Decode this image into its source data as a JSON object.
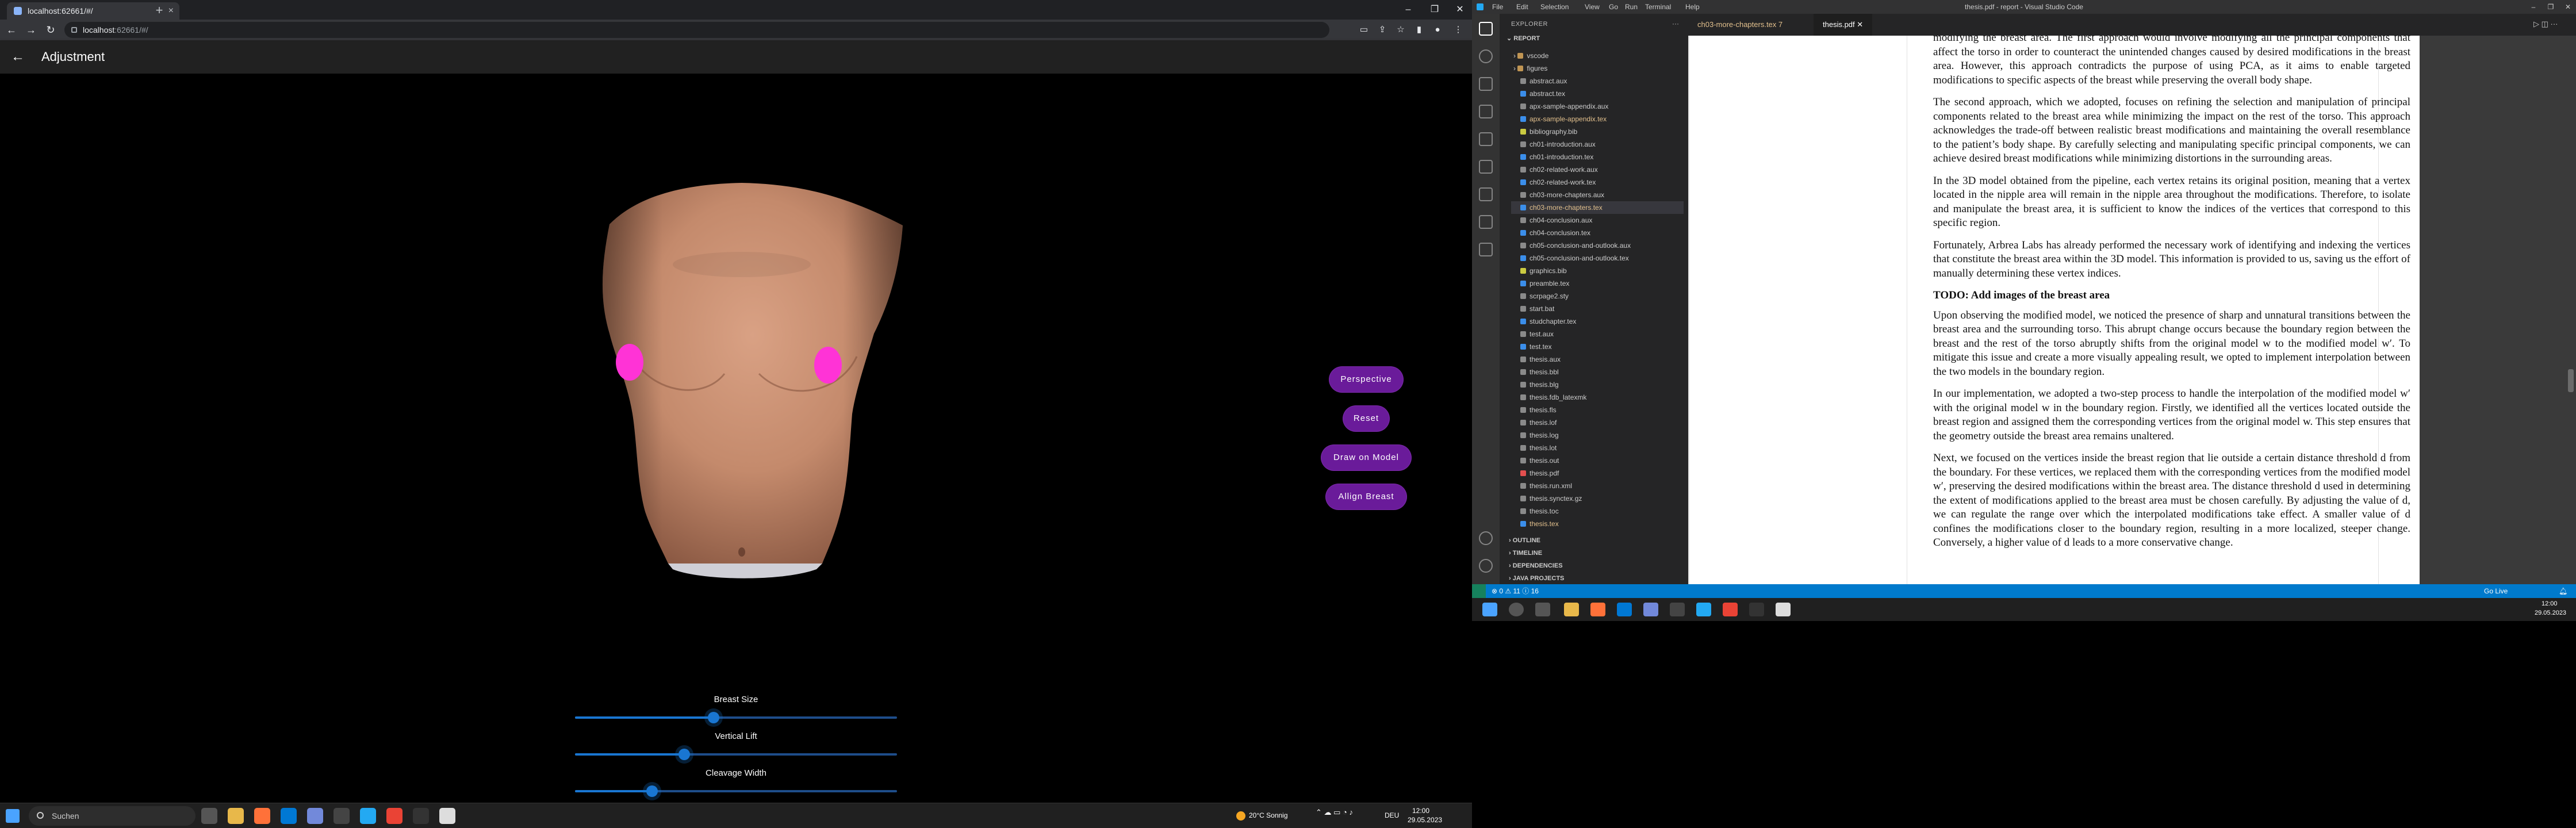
{
  "browser": {
    "tab_title": "localhost:62661/#/",
    "new_tab": "+",
    "url_host": "localhost",
    "url_rest": ":62661/#/"
  },
  "app": {
    "title": "Adjustment",
    "buttons": {
      "perspective": "Perspective",
      "reset": "Reset",
      "draw_on_model": "Draw on Model",
      "align_breast": "Allign Breast"
    },
    "sliders": [
      {
        "label": "Breast Size",
        "value": 0.43
      },
      {
        "label": "Vertical Lift",
        "value": 0.34
      },
      {
        "label": "Cleavage Width",
        "value": 0.24
      }
    ]
  },
  "left_taskbar": {
    "search_placeholder": "Suchen",
    "weather": "20°C  Sonnig",
    "lang": "DEU",
    "time": "12:00",
    "date": "29.05.2023"
  },
  "vscode": {
    "title": "thesis.pdf - report - Visual Studio Code",
    "menu": [
      "File",
      "Edit",
      "Selection",
      "View",
      "Go",
      "Run",
      "Terminal",
      "Help"
    ],
    "explorer_header": "EXPLORER",
    "root": "REPORT",
    "folders": [
      "vscode",
      "figures"
    ],
    "files": [
      {
        "name": "abstract.aux",
        "mod": false
      },
      {
        "name": "abstract.tex",
        "mod": false
      },
      {
        "name": "apx-sample-appendix.aux",
        "mod": false
      },
      {
        "name": "apx-sample-appendix.tex",
        "mod": true
      },
      {
        "name": "bibliography.bib",
        "mod": false
      },
      {
        "name": "ch01-introduction.aux",
        "mod": false
      },
      {
        "name": "ch01-introduction.tex",
        "mod": false
      },
      {
        "name": "ch02-related-work.aux",
        "mod": false
      },
      {
        "name": "ch02-related-work.tex",
        "mod": false
      },
      {
        "name": "ch03-more-chapters.aux",
        "mod": false
      },
      {
        "name": "ch03-more-chapters.tex",
        "mod": true
      },
      {
        "name": "ch04-conclusion.aux",
        "mod": false
      },
      {
        "name": "ch04-conclusion.tex",
        "mod": false
      },
      {
        "name": "ch05-conclusion-and-outlook.aux",
        "mod": false
      },
      {
        "name": "ch05-conclusion-and-outlook.tex",
        "mod": false
      },
      {
        "name": "graphics.bib",
        "mod": false
      },
      {
        "name": "preamble.tex",
        "mod": false
      },
      {
        "name": "scrpage2.sty",
        "mod": false
      },
      {
        "name": "start.bat",
        "mod": false
      },
      {
        "name": "studchapter.tex",
        "mod": false
      },
      {
        "name": "test.aux",
        "mod": false
      },
      {
        "name": "test.tex",
        "mod": false
      },
      {
        "name": "thesis.aux",
        "mod": false
      },
      {
        "name": "thesis.bbl",
        "mod": false
      },
      {
        "name": "thesis.blg",
        "mod": false
      },
      {
        "name": "thesis.fdb_latexmk",
        "mod": false
      },
      {
        "name": "thesis.fls",
        "mod": false
      },
      {
        "name": "thesis.lof",
        "mod": false
      },
      {
        "name": "thesis.log",
        "mod": false
      },
      {
        "name": "thesis.lot",
        "mod": false
      },
      {
        "name": "thesis.out",
        "mod": false
      },
      {
        "name": "thesis.pdf",
        "mod": false
      },
      {
        "name": "thesis.run.xml",
        "mod": false
      },
      {
        "name": "thesis.synctex.gz",
        "mod": false
      },
      {
        "name": "thesis.toc",
        "mod": false
      },
      {
        "name": "thesis.tex",
        "mod": true
      }
    ],
    "sections": [
      "OUTLINE",
      "TIMELINE",
      "DEPENDENCIES",
      "JAVA PROJECTS"
    ],
    "tabs": [
      "ch03-more-chapters.tex 7",
      "thesis.pdf"
    ],
    "status_left": "⊗ 0 ⚠ 11 ⓘ 16",
    "status_right": "Go Live",
    "pdf": {
      "p0": "modifying the breast area. The first approach would involve modifying all the principal components that affect the torso in order to counteract the unintended changes caused by desired modifications in the breast area. However, this approach contradicts the purpose of using PCA, as it aims to enable targeted modifications to specific aspects of the breast while preserving the overall body shape.",
      "p1": "The second approach, which we adopted, focuses on refining the selection and manipulation of principal components related to the breast area while minimizing the impact on the rest of the torso. This approach acknowledges the trade-off between realistic breast modifications and maintaining the overall resemblance to the patient’s body shape. By carefully selecting and manipulating specific principal components, we can achieve desired breast modifications while minimizing distortions in the surrounding areas.",
      "p2": "In the 3D model obtained from the pipeline, each vertex retains its original position, meaning that a vertex located in the nipple area will remain in the nipple area throughout the modifications. Therefore, to isolate and manipulate the breast area, it is sufficient to know the indices of the vertices that correspond to this specific region.",
      "p3": "Fortunately, Arbrea Labs has already performed the necessary work of identifying and indexing the vertices that constitute the breast area within the 3D model. This information is provided to us, saving us the effort of manually determining these vertex indices.",
      "h1": "TODO: Add images of the breast area",
      "p4": "Upon observing the modified model, we noticed the presence of sharp and unnatural transitions between the breast area and the surrounding torso. This abrupt change occurs because the boundary region between the breast and the rest of the torso abruptly shifts from the original model w to the modified model w′. To mitigate this issue and create a more visually appealing result, we opted to implement interpolation between the two models in the boundary region.",
      "p5": "In our implementation, we adopted a two-step process to handle the interpolation of the modified model w′ with the original model w in the boundary region. Firstly, we identified all the vertices located outside the breast region and assigned them the corresponding vertices from the original model w. This step ensures that the geometry outside the breast area remains unaltered.",
      "p6": "Next, we focused on the vertices inside the breast region that lie outside a certain distance threshold d from the boundary. For these vertices, we replaced them with the corresponding vertices from the modified model w′, preserving the desired modifications within the breast area. The distance threshold d used in determining the extent of modifications applied to the breast area must be chosen carefully. By adjusting the value of d, we can regulate the range over which the interpolated modifications take effect. A smaller value of d confines the modifications closer to the boundary region, resulting in a more localized, steeper change. Conversely, a higher value of d leads to a more conservative change."
    },
    "taskbar_time": "12:00",
    "taskbar_date": "29.05.2023"
  },
  "colors": {
    "accent_purple": "#6a1b9a",
    "slider_blue": "#1976d2",
    "marker_pink": "#ff33d6",
    "vscode_blue": "#007acc"
  }
}
